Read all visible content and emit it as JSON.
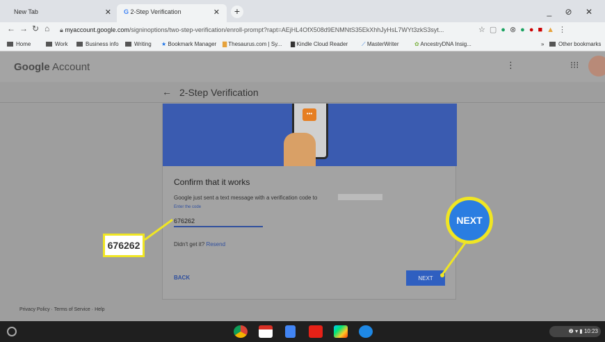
{
  "browser": {
    "tabs": [
      {
        "title": "New Tab"
      },
      {
        "title": "2-Step Verification"
      }
    ],
    "nav_icons": [
      "arrow-left-icon",
      "arrow-right-icon",
      "reload-icon",
      "home-icon"
    ],
    "url_host": "myaccount.google.com",
    "url_rest": "/signinoptions/two-step-verification/enroll-prompt?rapt=AEjHL4OfX508d9ENMNtS35EkXhhJyHsL7WYt3zkS3syt...",
    "window_controls": "_ ⊘ ✕"
  },
  "bookmarks": [
    {
      "label": "Home",
      "icon": "folder-icon"
    },
    {
      "label": "Work",
      "icon": "folder-icon"
    },
    {
      "label": "Business info",
      "icon": "folder-icon"
    },
    {
      "label": "Writing",
      "icon": "folder-icon"
    },
    {
      "label": "Bookmark Manager",
      "icon": "star-icon"
    },
    {
      "label": "Thesaurus.com | Sy...",
      "icon": "site-icon"
    },
    {
      "label": "Kindle Cloud Reader",
      "icon": "site-icon"
    },
    {
      "label": "MasterWriter",
      "icon": "site-icon"
    },
    {
      "label": "AncestryDNA Insig...",
      "icon": "site-icon"
    }
  ],
  "bookmarks_more": "»",
  "bookmarks_other": "Other bookmarks",
  "account": {
    "brand": "Google",
    "product": "Account"
  },
  "page": {
    "back_arrow": "←",
    "title": "2-Step Verification"
  },
  "card": {
    "heading": "Confirm that it works",
    "message": "Google just sent a text message with a verification code to",
    "field_label": "Enter the code",
    "code_value": "676262",
    "didnt_get": "Didn't get it?",
    "resend": "Resend",
    "back_label": "BACK",
    "next_label": "NEXT"
  },
  "callouts": {
    "code": "676262",
    "next": "NEXT",
    "color": "#f0e623"
  },
  "footer": {
    "privacy": "Privacy Policy",
    "terms": "Terms of Service",
    "help": "Help",
    "sep": "·"
  },
  "taskbar": {
    "apps": [
      "chrome-icon",
      "gmail-icon",
      "docs-icon",
      "youtube-icon",
      "play-store-icon",
      "chat-icon"
    ],
    "time": "10:23"
  }
}
